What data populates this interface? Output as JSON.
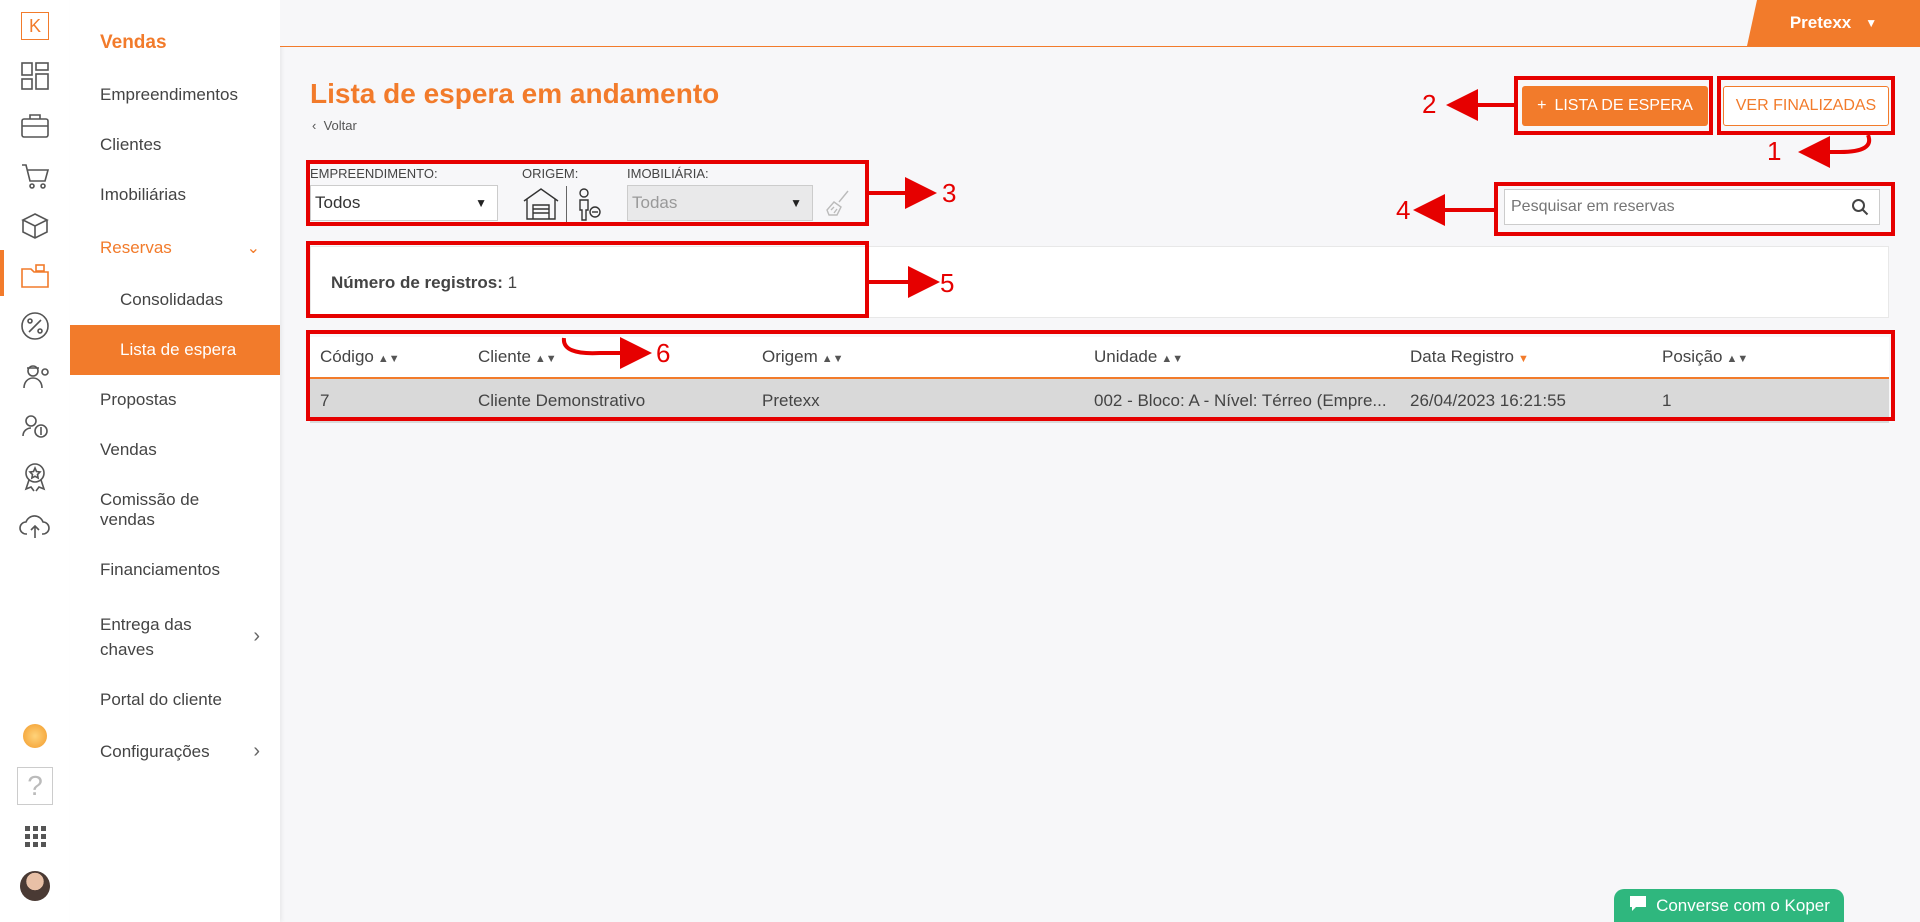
{
  "brand": {
    "logo_letter": "K",
    "accent": "#f27b2b"
  },
  "rail_icons": [
    "dashboard-icon",
    "briefcase-icon",
    "cart-icon",
    "boxes-icon",
    "folder-icon",
    "percent-icon",
    "engineer-icon",
    "users-icon",
    "award-icon",
    "cloud-upload-icon",
    "help-icon",
    "apps-grid-icon",
    "avatar"
  ],
  "menu": {
    "heading": "Vendas",
    "items": [
      "Empreendimentos",
      "Clientes",
      "Imobiliárias",
      "Reservas",
      "Consolidadas",
      "Lista de espera",
      "Propostas",
      "Vendas",
      "Comissão de\nvendas",
      "Financiamentos",
      "Entrega das\nchaves",
      "Portal do cliente",
      "Configurações"
    ]
  },
  "topbar": {
    "user": "Pretexx"
  },
  "page": {
    "title": "Lista de espera em andamento",
    "back": "Voltar",
    "add_button": "LISTA DE ESPERA",
    "add_plus": "+",
    "finished_button": "VER FINALIZADAS"
  },
  "filters": {
    "empreendimento_label": "EMPREENDIMENTO:",
    "empreendimento_value": "Todos",
    "origem_label": "ORIGEM:",
    "imobiliaria_label": "IMOBILIÁRIA:",
    "imobiliaria_value": "Todas"
  },
  "search": {
    "placeholder": "Pesquisar em reservas"
  },
  "count": {
    "label": "Número de registros:",
    "value": "1"
  },
  "table": {
    "headers": [
      "Código",
      "Cliente",
      "Origem",
      "Unidade",
      "Data Registro",
      "Posição"
    ],
    "rows": [
      [
        "7",
        "Cliente Demonstrativo",
        "Pretexx",
        "002 - Bloco: A - Nível: Térreo (Empre...",
        "26/04/2023 16:21:55",
        "1"
      ]
    ]
  },
  "annotations": [
    "1",
    "2",
    "3",
    "4",
    "5",
    "6"
  ],
  "chat": {
    "label": "Converse com o Koper"
  }
}
